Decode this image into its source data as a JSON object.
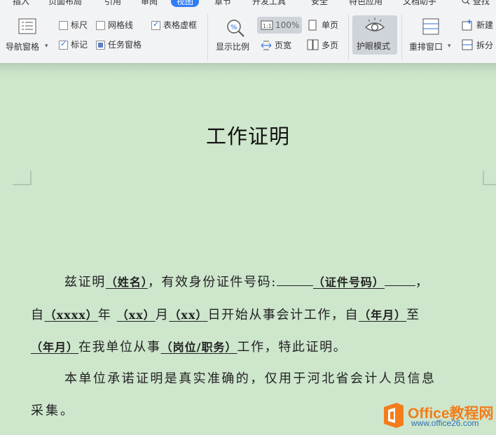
{
  "tabs": [
    "插入",
    "页面布局",
    "引用",
    "审阅",
    "视图",
    "章节",
    "开发工具",
    "安全",
    "特色应用",
    "文档助手",
    "查找"
  ],
  "ribbon": {
    "nav_pane": "导航窗格",
    "ruler": "标尺",
    "gridlines": "网格线",
    "table_dashed": "表格虚框",
    "markup": "标记",
    "task_pane": "任务窗格",
    "zoom_label": "显示比例",
    "zoom_value": "100%",
    "page_width": "页宽",
    "single_page": "单页",
    "multi_page": "多页",
    "eye_mode": "护眼模式",
    "arrange_window": "重排窗口",
    "new_window": "新建",
    "split": "拆分",
    "checks": {
      "ruler": false,
      "gridlines": false,
      "table_dashed": true,
      "markup": true,
      "task_pane": false
    },
    "accent_color": "#2f7df6"
  },
  "document": {
    "title": "工作证明",
    "p1_a": "兹证明",
    "name_field": "（姓名）",
    "p1_b": "，有效身份证件号码:",
    "id_field": "（证件号码）",
    "p1_c": "，",
    "l2_a": "自",
    "year_x": "（xxxx）",
    "l2_b": "年",
    "mon_x": "（xx）",
    "l2_c": "月",
    "day_x": "（xx）",
    "l2_d": "日开始从事会计工作，自",
    "year_m": "（年月）",
    "l2_e": "至",
    "year_m2": "（年月）",
    "l3_a": "在我单位从事",
    "post_field": "（岗位/职务）",
    "l3_b": "工作，特此证明。",
    "p2_a": "本单位承诺证明是真实准确的，仅用于河北省会计人员信息",
    "p2_b": "采集。",
    "background_color": "#cde6cc"
  },
  "watermark": {
    "brand": "Office教程网",
    "url": "www.office26.com",
    "colors": [
      "#f37d1b",
      "#2f6fb5"
    ]
  }
}
